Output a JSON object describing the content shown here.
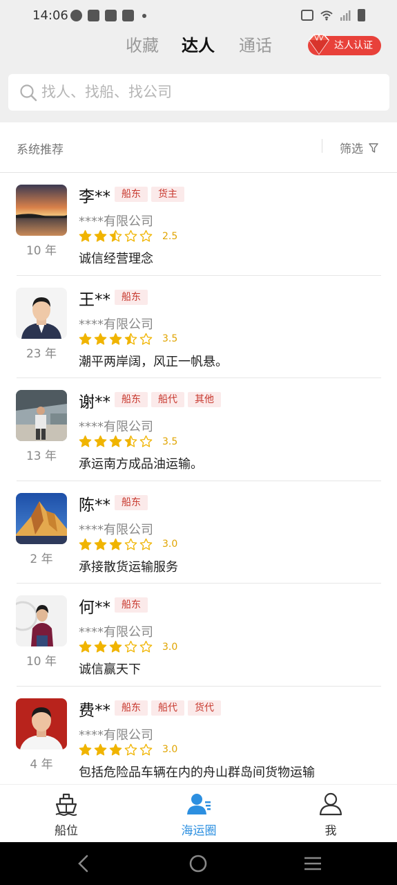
{
  "status_bar": {
    "time": "14:06"
  },
  "tabs": [
    {
      "label": "收藏",
      "active": false
    },
    {
      "label": "达人",
      "active": true
    },
    {
      "label": "通话",
      "active": false
    }
  ],
  "certify_button": "达人认证",
  "search": {
    "placeholder": "找人、找船、找公司"
  },
  "section": {
    "title": "系统推荐",
    "filter_label": "筛选"
  },
  "people": [
    {
      "name": "李**",
      "tags": [
        "船东",
        "货主"
      ],
      "company": "****有限公司",
      "rating": 2.5,
      "score": "2.5",
      "motto": "诚信经营理念",
      "years": "10 年",
      "avatar": "sunset-photo"
    },
    {
      "name": "王**",
      "tags": [
        "船东"
      ],
      "company": "****有限公司",
      "rating": 3.5,
      "score": "3.5",
      "motto": "潮平两岸阔，风正一帆悬。",
      "years": "23 年",
      "avatar": "man-suit-photo"
    },
    {
      "name": "谢**",
      "tags": [
        "船东",
        "船代",
        "其他"
      ],
      "company": "****有限公司",
      "rating": 3.5,
      "score": "3.5",
      "motto": "承运南方成品油运输。",
      "years": "13 年",
      "avatar": "man-hangar-photo"
    },
    {
      "name": "陈**",
      "tags": [
        "船东"
      ],
      "company": "****有限公司",
      "rating": 3.0,
      "score": "3.0",
      "motto": "承接散货运输服务",
      "years": "2 年",
      "avatar": "mountain-photo"
    },
    {
      "name": "何**",
      "tags": [
        "船东"
      ],
      "company": "****有限公司",
      "rating": 3.0,
      "score": "3.0",
      "motto": "诚信赢天下",
      "years": "10 年",
      "avatar": "woman-photo"
    },
    {
      "name": "费**",
      "tags": [
        "船东",
        "船代",
        "货代"
      ],
      "company": "****有限公司",
      "rating": 3.0,
      "score": "3.0",
      "motto": "包括危险品车辆在内的舟山群岛间货物运输",
      "years": "4 年",
      "avatar": "man-red-bg-photo"
    }
  ],
  "bottom_nav": [
    {
      "label": "船位",
      "icon": "ship-icon",
      "active": false
    },
    {
      "label": "海运圈",
      "icon": "community-icon",
      "active": true
    },
    {
      "label": "我",
      "icon": "profile-icon",
      "active": false
    }
  ],
  "colors": {
    "accent": "#2c8fe0",
    "tag_text": "#c83a30",
    "tag_bg": "#fbeaea",
    "star": "#f0b400",
    "cert": "#e8413a"
  }
}
